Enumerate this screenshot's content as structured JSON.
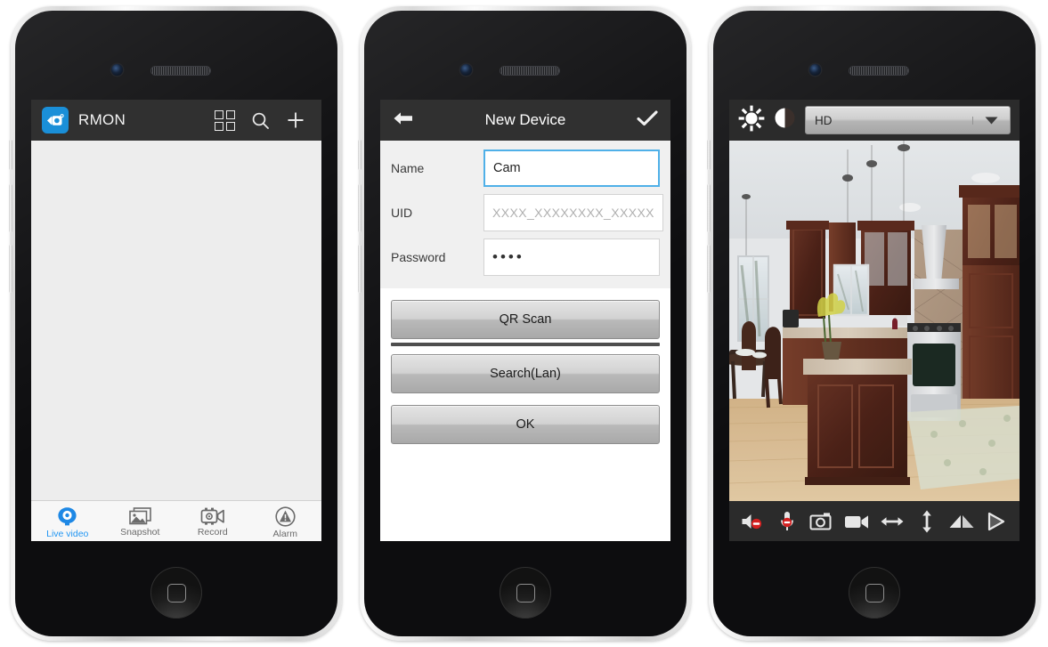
{
  "theme": {
    "bezel_silver": "#dcdcdc",
    "phone_black": "#0d0d0f",
    "topbar_dark": "#303030",
    "accent_blue": "#2196f3",
    "logo_blue": "#1a8fd8",
    "list_bg": "#ededed",
    "form_bg": "#f0f0f0",
    "field_focus": "#4fb0e8",
    "mute_red": "#d32020"
  },
  "phone1": {
    "name": "device-list-screen",
    "topbar": {
      "logo_icon": "camcorder-app-icon",
      "title": "RMON",
      "actions": [
        {
          "icon": "grid-view-icon",
          "name": "grid-view-button"
        },
        {
          "icon": "search-icon",
          "name": "search-button"
        },
        {
          "icon": "plus-icon",
          "name": "add-device-button"
        }
      ]
    },
    "list": {
      "empty": true,
      "items": []
    },
    "tabs": [
      {
        "label": "Live video",
        "icon": "live-video-icon",
        "active": true
      },
      {
        "label": "Snapshot",
        "icon": "snapshot-icon",
        "active": false
      },
      {
        "label": "Record",
        "icon": "record-icon",
        "active": false
      },
      {
        "label": "Alarm",
        "icon": "alarm-icon",
        "active": false
      }
    ]
  },
  "phone2": {
    "name": "new-device-screen",
    "topbar": {
      "back_icon": "back-arrow-icon",
      "title": "New Device",
      "confirm_icon": "checkmark-icon"
    },
    "fields": [
      {
        "label": "Name",
        "value": "Cam",
        "placeholder": "",
        "focused": true,
        "type": "text"
      },
      {
        "label": "UID",
        "value": "",
        "placeholder": "XXXX_XXXXXXXX_XXXXX",
        "focused": false,
        "type": "text"
      },
      {
        "label": "Password",
        "value": "••••",
        "placeholder": "",
        "focused": false,
        "type": "password"
      }
    ],
    "buttons": [
      {
        "label": "QR Scan",
        "name": "qr-scan-button"
      },
      {
        "label": "Search(Lan)",
        "name": "search-lan-button"
      },
      {
        "label": "OK",
        "name": "ok-button"
      }
    ]
  },
  "phone3": {
    "name": "live-view-screen",
    "topbar": {
      "brightness_icon": "brightness-sun-icon",
      "contrast_icon": "contrast-icon",
      "quality": {
        "value": "HD",
        "name": "video-quality-select"
      }
    },
    "video": {
      "name": "live-video-feed",
      "description": "kitchen camera feed"
    },
    "controls": [
      {
        "icon": "speaker-muted-icon",
        "name": "speaker-toggle",
        "muted": true
      },
      {
        "icon": "microphone-muted-icon",
        "name": "microphone-toggle",
        "muted": true
      },
      {
        "icon": "camera-snapshot-icon",
        "name": "snapshot-button",
        "muted": false
      },
      {
        "icon": "video-record-icon",
        "name": "record-button",
        "muted": false
      },
      {
        "icon": "pan-horizontal-icon",
        "name": "pan-horizontal-button",
        "muted": false
      },
      {
        "icon": "tilt-vertical-icon",
        "name": "tilt-vertical-button",
        "muted": false
      },
      {
        "icon": "mirror-flip-icon",
        "name": "mirror-button",
        "muted": false
      },
      {
        "icon": "play-icon",
        "name": "play-button",
        "muted": false
      }
    ]
  }
}
